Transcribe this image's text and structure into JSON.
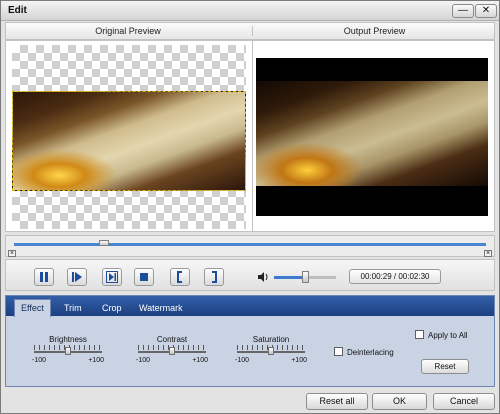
{
  "window": {
    "title": "Edit"
  },
  "titlebar": {
    "minimize_glyph": "—",
    "close_glyph": "✕"
  },
  "preview": {
    "original_label": "Original Preview",
    "output_label": "Output Preview"
  },
  "timeline": {
    "position_fraction": 0.19,
    "start_marker": "×",
    "end_marker": "×"
  },
  "controls": {
    "buttons": [
      "pause",
      "play-frame",
      "next-frame",
      "stop",
      "mark-in",
      "mark-out"
    ],
    "volume_fraction": 0.5,
    "time_display": "00:00:29 / 00:02:30"
  },
  "tabs": [
    "Effect",
    "Trim",
    "Crop",
    "Watermark"
  ],
  "active_tab": "Effect",
  "effect": {
    "brightness": {
      "label": "Brightness",
      "min": "-100",
      "max": "+100",
      "value": 0
    },
    "contrast": {
      "label": "Contrast",
      "min": "-100",
      "max": "+100",
      "value": 0
    },
    "saturation": {
      "label": "Saturation",
      "min": "-100",
      "max": "+100",
      "value": 0
    },
    "deinterlacing_label": "Deinterlacing",
    "apply_to_all_label": "Apply to All",
    "reset_label": "Reset"
  },
  "footer": {
    "reset_all": "Reset all",
    "ok": "OK",
    "cancel": "Cancel"
  },
  "colors": {
    "tab_bar": "#1c3f80",
    "accent": "#4a86d0"
  }
}
